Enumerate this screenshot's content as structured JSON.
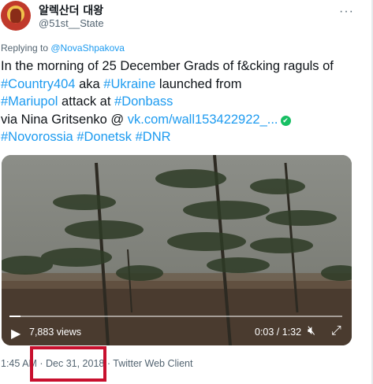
{
  "tweet": {
    "display_name": "알렉산더 대왕",
    "handle": "@51st__State",
    "replying_prefix": "Replying to ",
    "replying_to": "@NovaShpakova",
    "text_parts": {
      "p1": "In the morning of 25 December Grads of f&cking raguls of ",
      "h1": "#Country404",
      "p2": " aka ",
      "h2": "#Ukraine",
      "p3": " launched from ",
      "h3": "#Mariupol",
      "p4": " attack at ",
      "h4": "#Donbass",
      "p5": " via Nina Gritsenko @ ",
      "link": "vk.com/wall153422922_...",
      "h5": "#Novorossia",
      "h6": "#Donetsk",
      "h7": "#DNR"
    },
    "verified_icon": "✔",
    "more_icon": "···"
  },
  "video": {
    "views": "7,883 views",
    "time": "0:03 / 1:32",
    "progress_fraction": 0.033,
    "play_icon": "play-icon",
    "mute_icon": "volume-muted-icon",
    "fullscreen_icon": "fullscreen-icon"
  },
  "meta": {
    "time": "1:45 AM",
    "date": "· Dec 31, 2018",
    "client": "· Twitter Web Client"
  },
  "colors": {
    "link": "#1d9bf0",
    "highlight": "#c8102e",
    "muted_text": "#536471"
  }
}
